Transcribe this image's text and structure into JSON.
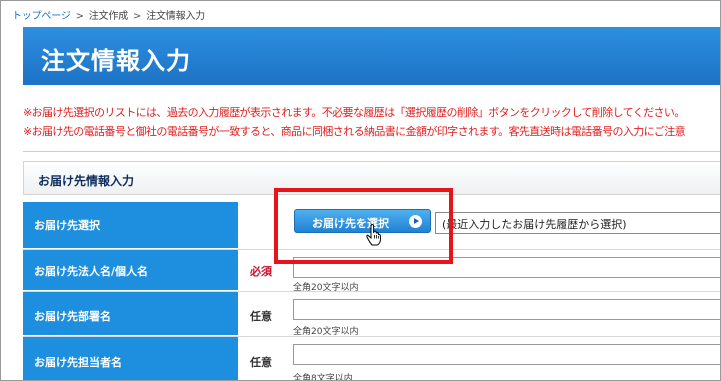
{
  "breadcrumb": {
    "items": [
      "トップページ",
      "注文作成",
      "注文情報入力"
    ],
    "separator": ">"
  },
  "page_title": "注文情報入力",
  "notices": [
    "※お届け先選択のリストには、過去の入力履歴が表示されます。不必要な履歴は「選択履歴の削除」ボタンをクリックして削除してください。",
    "※お届け先の電話番号と御社の電話番号が一致すると、商品に同梱される納品書に金額が印字されます。客先直送時は電話番号の入力にご注意"
  ],
  "section_title": "お届け先情報入力",
  "form": {
    "select_row": {
      "label": "お届け先選択",
      "button_label": "お届け先を選択",
      "history_text": "(最近入力したお届け先履歴から選択)"
    },
    "rows": [
      {
        "label": "お届け先法人名/個人名",
        "requirement": "必須",
        "hint": "全角20文字以内"
      },
      {
        "label": "お届け先部署名",
        "requirement": "任意",
        "hint": "全角20文字以内"
      },
      {
        "label": "お届け先担当者名",
        "requirement": "任意",
        "hint": "全角8文字以内"
      }
    ]
  },
  "colors": {
    "title_bar": "#1d73c6",
    "label_cell": "#1d8fde",
    "notice_text": "#e02020",
    "required_text": "#c8102e",
    "highlight": "#e8141c"
  },
  "icons": [
    "play-icon",
    "hand-cursor-icon"
  ]
}
